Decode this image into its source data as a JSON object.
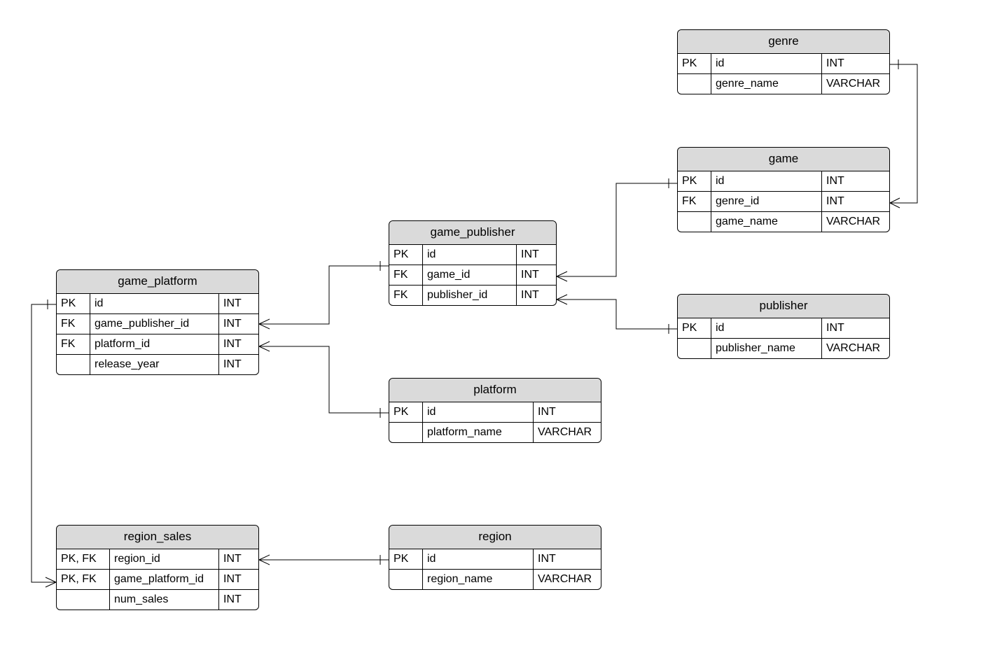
{
  "entities": {
    "genre": {
      "title": "genre",
      "rows": [
        {
          "key": "PK",
          "col": "id",
          "type": "INT"
        },
        {
          "key": "",
          "col": "genre_name",
          "type": "VARCHAR"
        }
      ]
    },
    "game": {
      "title": "game",
      "rows": [
        {
          "key": "PK",
          "col": "id",
          "type": "INT"
        },
        {
          "key": "FK",
          "col": "genre_id",
          "type": "INT"
        },
        {
          "key": "",
          "col": "game_name",
          "type": "VARCHAR"
        }
      ]
    },
    "game_publisher": {
      "title": "game_publisher",
      "rows": [
        {
          "key": "PK",
          "col": "id",
          "type": "INT"
        },
        {
          "key": "FK",
          "col": "game_id",
          "type": "INT"
        },
        {
          "key": "FK",
          "col": "publisher_id",
          "type": "INT"
        }
      ]
    },
    "publisher": {
      "title": "publisher",
      "rows": [
        {
          "key": "PK",
          "col": "id",
          "type": "INT"
        },
        {
          "key": "",
          "col": "publisher_name",
          "type": "VARCHAR"
        }
      ]
    },
    "game_platform": {
      "title": "game_platform",
      "rows": [
        {
          "key": "PK",
          "col": "id",
          "type": "INT"
        },
        {
          "key": "FK",
          "col": "game_publisher_id",
          "type": "INT"
        },
        {
          "key": "FK",
          "col": "platform_id",
          "type": "INT"
        },
        {
          "key": "",
          "col": "release_year",
          "type": "INT"
        }
      ]
    },
    "platform": {
      "title": "platform",
      "rows": [
        {
          "key": "PK",
          "col": "id",
          "type": "INT"
        },
        {
          "key": "",
          "col": "platform_name",
          "type": "VARCHAR"
        }
      ]
    },
    "region_sales": {
      "title": "region_sales",
      "rows": [
        {
          "key": "PK, FK",
          "col": "region_id",
          "type": "INT"
        },
        {
          "key": "PK, FK",
          "col": "game_platform_id",
          "type": "INT"
        },
        {
          "key": "",
          "col": "num_sales",
          "type": "INT"
        }
      ]
    },
    "region": {
      "title": "region",
      "rows": [
        {
          "key": "PK",
          "col": "id",
          "type": "INT"
        },
        {
          "key": "",
          "col": "region_name",
          "type": "VARCHAR"
        }
      ]
    }
  },
  "relationships": [
    {
      "from": "game",
      "to": "genre",
      "type": "many-to-one"
    },
    {
      "from": "game_publisher",
      "to": "game",
      "type": "many-to-one"
    },
    {
      "from": "game_publisher",
      "to": "publisher",
      "type": "many-to-one"
    },
    {
      "from": "game_platform",
      "to": "game_publisher",
      "type": "many-to-one"
    },
    {
      "from": "game_platform",
      "to": "platform",
      "type": "many-to-one"
    },
    {
      "from": "region_sales",
      "to": "region",
      "type": "many-to-one"
    },
    {
      "from": "region_sales",
      "to": "game_platform",
      "type": "many-to-one"
    }
  ]
}
